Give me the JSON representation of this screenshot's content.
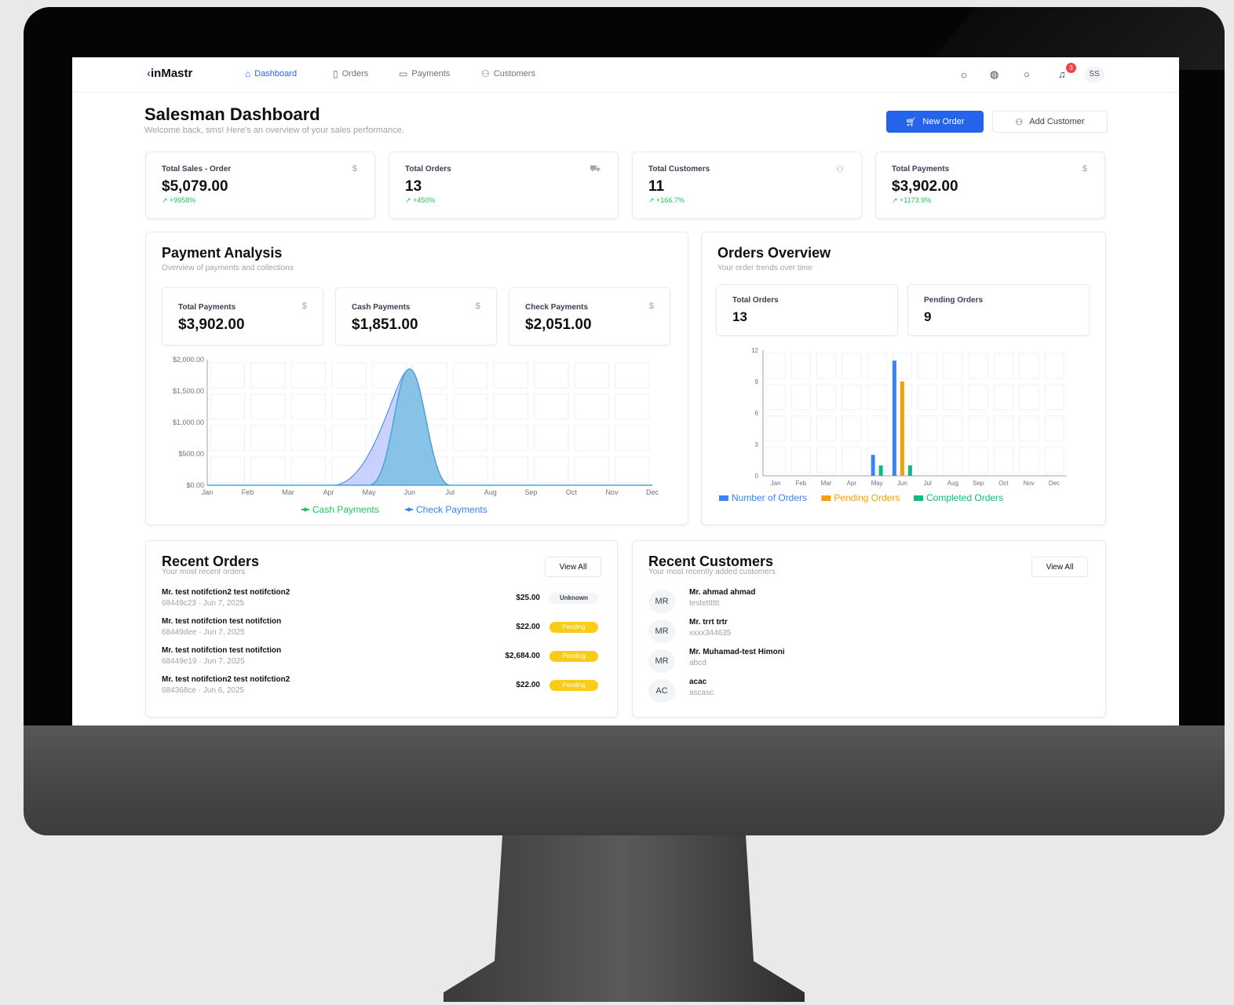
{
  "nav": {
    "brand_prefix": "‹",
    "brand": "inMastr",
    "links": [
      {
        "label": "Dashboard",
        "icon": "home-icon",
        "active": true
      },
      {
        "label": "Orders",
        "icon": "document-icon",
        "active": false
      },
      {
        "label": "Payments",
        "icon": "card-icon",
        "active": false
      },
      {
        "label": "Customers",
        "icon": "users-icon",
        "active": false
      }
    ],
    "notification_count": "3",
    "user_initials": "SS"
  },
  "header": {
    "title": "Salesman Dashboard",
    "subtitle": "Welcome back, sms! Here's an overview of your sales performance.",
    "new_order": "New Order",
    "add_customer": "Add Customer"
  },
  "stats": [
    {
      "title": "Total Sales - Order",
      "value": "$5,079.00",
      "change": "↗ +9958%",
      "icon": "dollar-icon"
    },
    {
      "title": "Total Orders",
      "value": "13",
      "change": "↗ +450%",
      "icon": "cart-icon"
    },
    {
      "title": "Total Customers",
      "value": "11",
      "change": "↗ +166.7%",
      "icon": "users-icon"
    },
    {
      "title": "Total Payments",
      "value": "$3,902.00",
      "change": "↗ +1173.9%",
      "icon": "dollar-icon"
    }
  ],
  "payment_analysis": {
    "title": "Payment Analysis",
    "subtitle": "Overview of payments and collections",
    "minis": [
      {
        "title": "Total Payments",
        "value": "$3,902.00"
      },
      {
        "title": "Cash Payments",
        "value": "$1,851.00"
      },
      {
        "title": "Check Payments",
        "value": "$2,051.00"
      }
    ]
  },
  "orders_overview": {
    "title": "Orders Overview",
    "subtitle": "Your order trends over time",
    "minis": [
      {
        "title": "Total Orders",
        "value": "13"
      },
      {
        "title": "Pending Orders",
        "value": "9"
      }
    ]
  },
  "recent_orders": {
    "title": "Recent Orders",
    "subtitle": "Your most recent orders",
    "view_all": "View All",
    "rows": [
      {
        "name": "Mr. test notifction2 test notifction2",
        "meta": "68449c23 · Jun 7, 2025",
        "amount": "$25.00",
        "status": "Unknown"
      },
      {
        "name": "Mr. test notifction test notifction",
        "meta": "68449dee · Jun 7, 2025",
        "amount": "$22.00",
        "status": "Pending"
      },
      {
        "name": "Mr. test notifction test notifction",
        "meta": "68449e19 · Jun 7, 2025",
        "amount": "$2,684.00",
        "status": "Pending"
      },
      {
        "name": "Mr. test notifction2 test notifction2",
        "meta": "684368ce · Jun 6, 2025",
        "amount": "$22.00",
        "status": "Pending"
      }
    ]
  },
  "recent_customers": {
    "title": "Recent Customers",
    "subtitle": "Your most recently added customers",
    "view_all": "View All",
    "rows": [
      {
        "initials": "MR",
        "name": "Mr. ahmad ahmad",
        "sub": "testetttttt"
      },
      {
        "initials": "MR",
        "name": "Mr. trrt trtr",
        "sub": "xxxx344635"
      },
      {
        "initials": "MR",
        "name": "Mr. Muhamad-test Himoni",
        "sub": "abcd"
      },
      {
        "initials": "AC",
        "name": "acac",
        "sub": "ascasc"
      }
    ]
  },
  "colors": {
    "accent": "#2563eb",
    "cash": "#22c55e",
    "check": "#3b82f6",
    "orders": "#3b82f6",
    "pending": "#f59e0b",
    "completed": "#10b981"
  },
  "chart_data": [
    {
      "type": "area",
      "categories": [
        "Jan",
        "Feb",
        "Mar",
        "Apr",
        "May",
        "Jun",
        "Jul",
        "Aug",
        "Sep",
        "Oct",
        "Nov",
        "Dec"
      ],
      "ylim": [
        0,
        2000
      ],
      "yticks": [
        "$0.00",
        "$500.00",
        "$1,000.00",
        "$1,500.00",
        "$2,000.00"
      ],
      "series": [
        {
          "name": "Cash Payments",
          "values": [
            0,
            0,
            0,
            0,
            0,
            1851,
            0,
            0,
            0,
            0,
            0,
            0
          ]
        },
        {
          "name": "Check Payments",
          "values": [
            0,
            0,
            0,
            0,
            0,
            1851,
            0,
            0,
            0,
            0,
            0,
            0
          ]
        }
      ],
      "legend": "bottom"
    },
    {
      "type": "bar",
      "categories": [
        "Jan",
        "Feb",
        "Mar",
        "Apr",
        "May",
        "Jun",
        "Jul",
        "Aug",
        "Sep",
        "Oct",
        "Nov",
        "Dec"
      ],
      "ylim": [
        0,
        12
      ],
      "yticks": [
        "0",
        "3",
        "6",
        "9",
        "12"
      ],
      "series": [
        {
          "name": "Number of Orders",
          "values": [
            0,
            0,
            0,
            0,
            2,
            11,
            0,
            0,
            0,
            0,
            0,
            0
          ]
        },
        {
          "name": "Pending Orders",
          "values": [
            0,
            0,
            0,
            0,
            0,
            9,
            0,
            0,
            0,
            0,
            0,
            0
          ]
        },
        {
          "name": "Completed Orders",
          "values": [
            0,
            0,
            0,
            0,
            1,
            1,
            0,
            0,
            0,
            0,
            0,
            0
          ]
        }
      ],
      "legend": "bottom"
    }
  ]
}
